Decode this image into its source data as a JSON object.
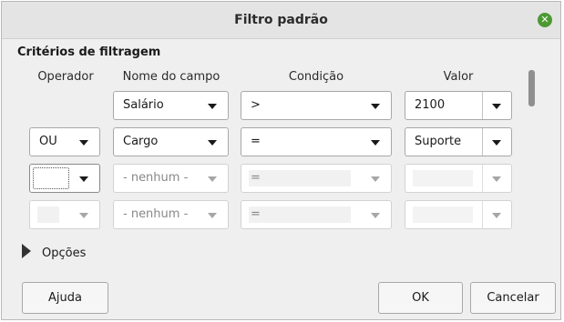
{
  "dialog": {
    "title": "Filtro padrão",
    "close_icon": "close-icon",
    "accent": "#4d9a35"
  },
  "criteria": {
    "section_label": "Critérios de filtragem",
    "headers": {
      "operator": "Operador",
      "field": "Nome do campo",
      "condition": "Condição",
      "value": "Valor"
    },
    "rows": [
      {
        "operator": "",
        "field": "Salário",
        "condition": ">",
        "value": "2100",
        "enabled": true
      },
      {
        "operator": "OU",
        "field": "Cargo",
        "condition": "=",
        "value": "Suporte",
        "enabled": true
      },
      {
        "operator": "",
        "field": "- nenhum -",
        "condition": "=",
        "value": "",
        "enabled": true
      },
      {
        "operator": "",
        "field": "- nenhum -",
        "condition": "=",
        "value": "",
        "enabled": false
      }
    ]
  },
  "options": {
    "label": "Opções",
    "icon": "expander-triangle-icon"
  },
  "buttons": {
    "help": "Ajuda",
    "ok": "OK",
    "cancel": "Cancelar"
  }
}
